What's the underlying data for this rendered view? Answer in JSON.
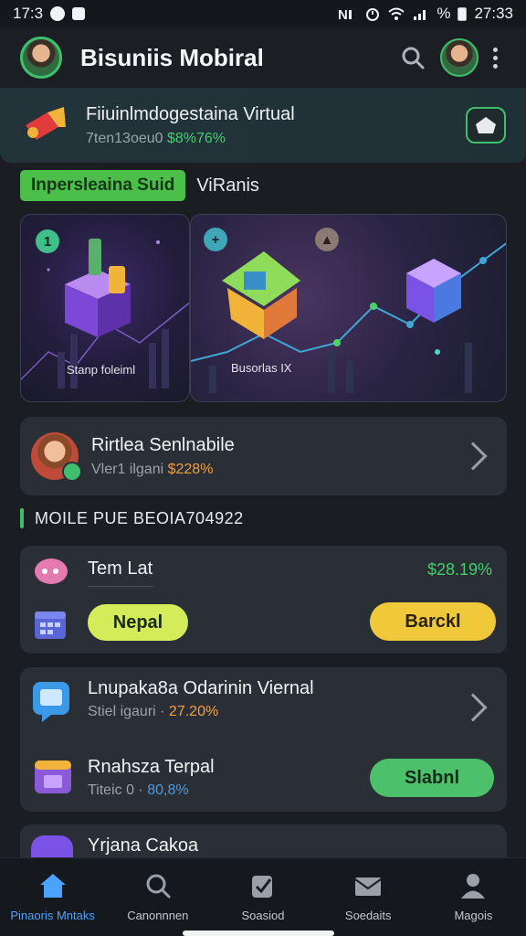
{
  "status": {
    "time_left": "17:3",
    "time_right": "27:33",
    "battery": "%"
  },
  "app": {
    "title": "Bisuniis Mobiral"
  },
  "banner": {
    "title": "Fiiuinlmdogestaina Virtual",
    "sub_prefix": "7ten13oeu0",
    "sub_value": "$8%76%"
  },
  "tabs": {
    "active": "Inpersleaina Suid",
    "other": "ViRanis"
  },
  "hero": {
    "left_label": "Stanp foleiml",
    "right_label": "Busorlas IX",
    "left_badge": "1",
    "right_badge": "+"
  },
  "profile_row": {
    "title": "Rirtlea Senlnabile",
    "sub_prefix": "Vler1 ilgani",
    "value": "$228%"
  },
  "section": {
    "title": "MOILE PUE BEOIA704922"
  },
  "trade_card": {
    "title": "Tem Lat",
    "value": "$28.19%",
    "left_button": "Nepal",
    "right_button": "Barckl"
  },
  "list_card": {
    "row1_title": "Lnupaka8a Odarinin Viernal",
    "row1_sub_prefix": "Stiel igauri",
    "row1_value": "27.20%",
    "row2_title": "Rnahsza Terpal",
    "row2_sub_prefix": "Titeic 0",
    "row2_value": "80,8%",
    "row2_button": "Slabnl"
  },
  "partial_row": {
    "title": "Yrjana Cakoa"
  },
  "nav": [
    {
      "label": "Pinaoris Mntaks"
    },
    {
      "label": "Canonnnen"
    },
    {
      "label": "Soasiod"
    },
    {
      "label": "Soedaits"
    },
    {
      "label": "Magois"
    }
  ],
  "colors": {
    "accent_green": "#3fbf6b",
    "accent_yellow": "#f0c93a",
    "active_blue": "#4aa3ff"
  }
}
